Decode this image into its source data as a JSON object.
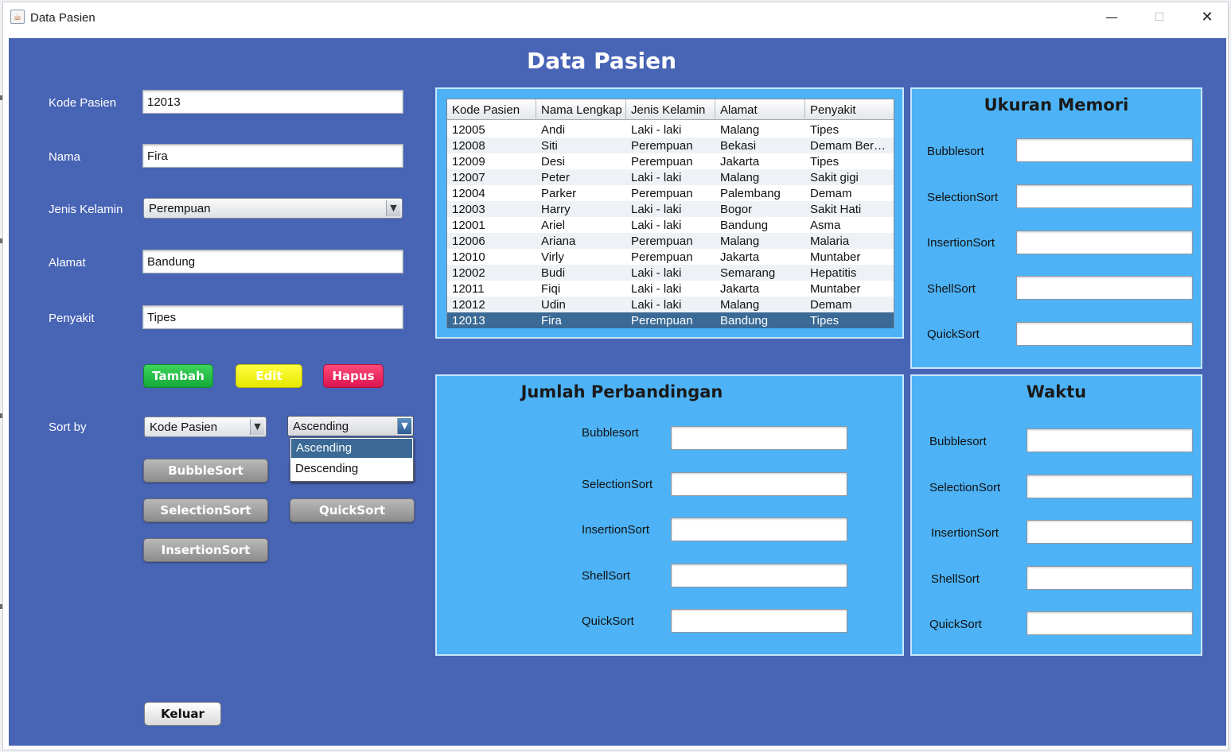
{
  "window": {
    "title": "Data Pasien",
    "app_icon": "java-icon",
    "controls": {
      "minimize": "—",
      "maximize": "☐",
      "close": "✕"
    }
  },
  "heading": "Data Pasien",
  "form": {
    "kode_label": "Kode Pasien",
    "kode_value": "12013",
    "nama_label": "Nama",
    "nama_value": "Fira",
    "jk_label": "Jenis Kelamin",
    "jk_value": "Perempuan",
    "alamat_label": "Alamat",
    "alamat_value": "Bandung",
    "penyakit_label": "Penyakit",
    "penyakit_value": "Tipes"
  },
  "actions": {
    "tambah": "Tambah",
    "edit": "Edit",
    "hapus": "Hapus"
  },
  "sort": {
    "label": "Sort by",
    "field_value": "Kode Pasien",
    "order_value": "Ascending",
    "order_options": [
      "Ascending",
      "Descending"
    ],
    "bubble": "BubbleSort",
    "selection": "SelectionSort",
    "insertion": "InsertionSort",
    "quick": "QuickSort"
  },
  "exit_label": "Keluar",
  "table": {
    "columns": [
      "Kode Pasien",
      "Nama Lengkap",
      "Jenis Kelamin",
      "Alamat",
      "Penyakit"
    ],
    "rows": [
      [
        "12005",
        "Andi",
        "Laki - laki",
        "Malang",
        "Tipes"
      ],
      [
        "12008",
        "Siti",
        "Perempuan",
        "Bekasi",
        "Demam Berd..."
      ],
      [
        "12009",
        "Desi",
        "Perempuan",
        "Jakarta",
        "Tipes"
      ],
      [
        "12007",
        "Peter",
        "Laki - laki",
        "Malang",
        "Sakit gigi"
      ],
      [
        "12004",
        "Parker",
        "Perempuan",
        "Palembang",
        "Demam"
      ],
      [
        "12003",
        "Harry",
        "Laki - laki",
        "Bogor",
        "Sakit Hati"
      ],
      [
        "12001",
        "Ariel",
        "Laki - laki",
        "Bandung",
        "Asma"
      ],
      [
        "12006",
        "Ariana",
        "Perempuan",
        "Malang",
        "Malaria"
      ],
      [
        "12010",
        "Virly",
        "Perempuan",
        "Jakarta",
        "Muntaber"
      ],
      [
        "12002",
        "Budi",
        "Laki - laki",
        "Semarang",
        "Hepatitis"
      ],
      [
        "12011",
        "Fiqi",
        "Laki - laki",
        "Jakarta",
        "Muntaber"
      ],
      [
        "12012",
        "Udin",
        "Laki - laki",
        "Malang",
        "Demam"
      ],
      [
        "12013",
        "Fira",
        "Perempuan",
        "Bandung",
        "Tipes"
      ]
    ],
    "selected_row": 12
  },
  "memori": {
    "title": "Ukuran Memori",
    "labels": [
      "Bubblesort",
      "SelectionSort",
      "InsertionSort",
      "ShellSort",
      "QuickSort"
    ]
  },
  "perbandingan": {
    "title": "Jumlah Perbandingan",
    "labels": [
      "Bubblesort",
      "SelectionSort",
      "InsertionSort",
      "ShellSort",
      "QuickSort"
    ]
  },
  "waktu": {
    "title": "Waktu",
    "labels": [
      "Bubblesort",
      "SelectionSort",
      "InsertionSort",
      "ShellSort",
      "QuickSort"
    ]
  },
  "colors": {
    "background": "#4864b5",
    "panel": "#4db3f6",
    "selection": "#3a6a95",
    "tambah": "#14a83a",
    "edit": "#e6e600",
    "hapus": "#dc1450"
  }
}
